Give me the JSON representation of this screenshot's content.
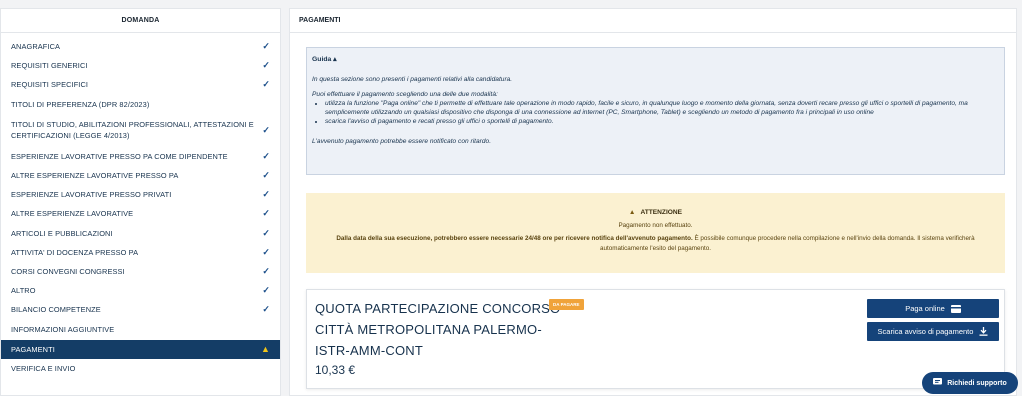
{
  "sidebar": {
    "title": "DOMANDA",
    "items": [
      {
        "label": "ANAGRAFICA",
        "status": "check"
      },
      {
        "label": "REQUISITI GENERICI",
        "status": "check"
      },
      {
        "label": "REQUISITI SPECIFICI",
        "status": "check"
      },
      {
        "label": "TITOLI DI PREFERENZA (DPR 82/2023)",
        "status": "none"
      },
      {
        "label": "TITOLI DI STUDIO, ABILITAZIONI PROFESSIONALI, ATTESTAZIONI E CERTIFICAZIONI (LEGGE 4/2013)",
        "status": "check"
      },
      {
        "label": "ESPERIENZE LAVORATIVE PRESSO PA COME DIPENDENTE",
        "status": "check"
      },
      {
        "label": "ALTRE ESPERIENZE LAVORATIVE PRESSO PA",
        "status": "check"
      },
      {
        "label": "ESPERIENZE LAVORATIVE PRESSO PRIVATI",
        "status": "check"
      },
      {
        "label": "ALTRE ESPERIENZE LAVORATIVE",
        "status": "check"
      },
      {
        "label": "ARTICOLI E PUBBLICAZIONI",
        "status": "check"
      },
      {
        "label": "ATTIVITA' DI DOCENZA PRESSO PA",
        "status": "check"
      },
      {
        "label": "CORSI CONVEGNI CONGRESSI",
        "status": "check"
      },
      {
        "label": "ALTRO",
        "status": "check"
      },
      {
        "label": "BILANCIO COMPETENZE",
        "status": "check"
      },
      {
        "label": "INFORMAZIONI AGGIUNTIVE",
        "status": "none"
      },
      {
        "label": "PAGAMENTI",
        "status": "warning"
      },
      {
        "label": "VERIFICA E INVIO",
        "status": "none"
      }
    ]
  },
  "main": {
    "title": "PAGAMENTI",
    "guide": {
      "toggle": "Guida",
      "intro": "In questa sezione sono presenti i pagamenti relativi alla candidatura.",
      "modes": "Puoi effettuare il pagamento scegliendo una delle due modalità:",
      "bullet1": "utilizza la funzione \"Paga online\" che ti permette di effettuare tale operazione in modo rapido, facile e sicuro, in qualunque luogo e momento della giornata, senza doverti recare presso gli uffici o sportelli di pagamento, ma semplicemente utilizzando un qualsiasi dispositivo che disponga di una connessione ad internet (PC, Smartphone, Tablet) e scegliendo un metodo di pagamento fra i principali in uso online",
      "bullet2": "scarica l'avviso di pagamento e recati presso gli uffici o sportelli di pagamento.",
      "note": "L'avvenuto pagamento potrebbe essere notificato con ritardo."
    },
    "alert": {
      "title": "ATTENZIONE",
      "message": "Pagamento non effettuato.",
      "detail_bold": "Dalla data della sua esecuzione, potrebbero essere necessarie 24/48 ore per ricevere notifica dell'avvenuto pagamento.",
      "detail_rest": "È possibile comunque procedere nella compilazione e nell'invio della domanda. Il sistema verificherà automaticamente l'esito del pagamento.",
      "color": "#fbf1d1"
    },
    "payment": {
      "title": "QUOTA PARTECIPAZIONE CONCORSO CITTÀ METROPOLITANA PALERMO-ISTR-AMM-CONT",
      "badge": "DA PAGARE",
      "badge_color": "#f0a33a",
      "amount": "10,33 €",
      "pay_button": "Paga online",
      "download_button": "Scarica avviso di pagamento"
    }
  },
  "support_button": "Richiedi supporto",
  "colors": {
    "primary": "#15437a",
    "active_nav": "#143d66"
  }
}
